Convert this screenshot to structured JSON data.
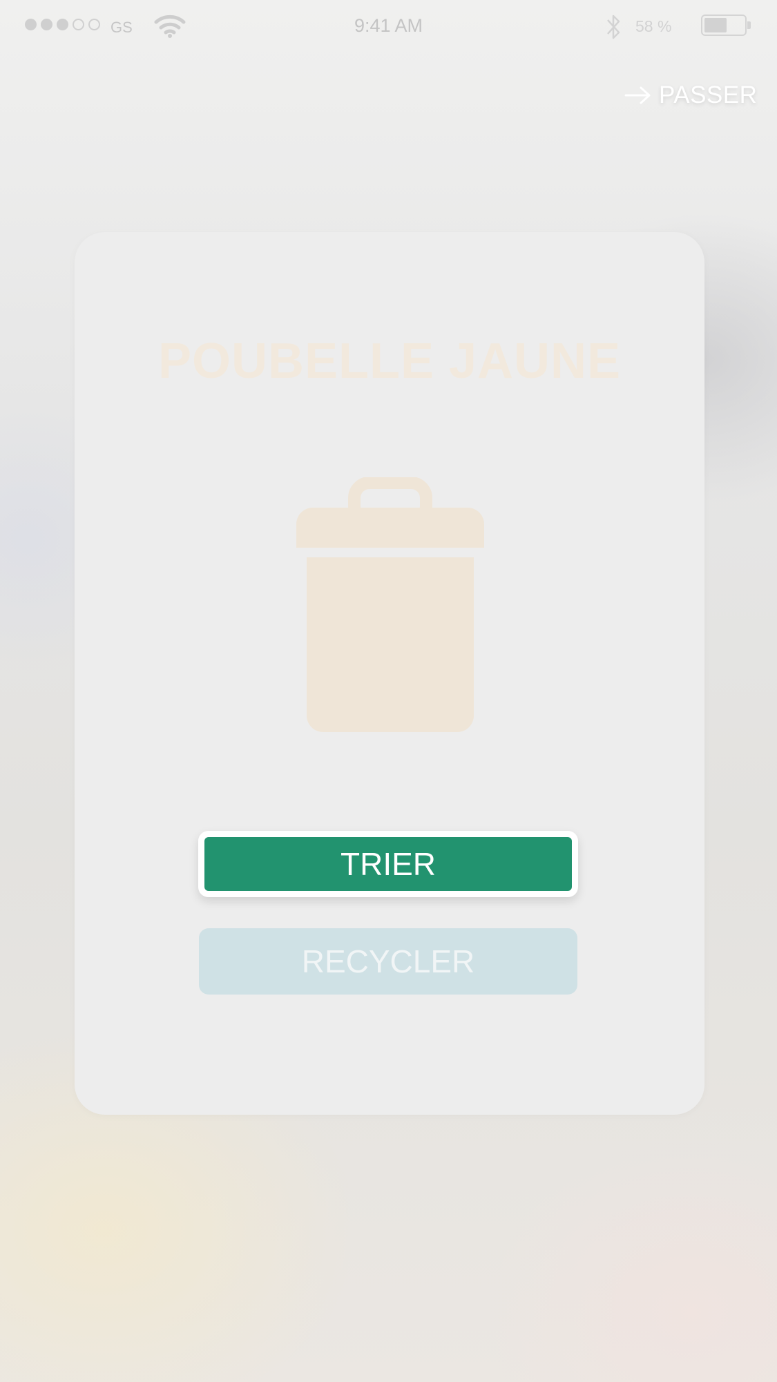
{
  "status_bar": {
    "signal_filled": 3,
    "signal_total": 5,
    "carrier": "GS",
    "time": "9:41 AM",
    "battery_percent": "58 %",
    "battery_level": 0.58
  },
  "header": {
    "skip_label": "PASSER",
    "skip_icon": "arrow-right-icon"
  },
  "card": {
    "title": "POUBELLE JAUNE",
    "illustration_icon": "trash-bin-icon",
    "title_color": "#f2e9dd",
    "illustration_color": "#efe5d7",
    "primary_button": {
      "label": "TRIER",
      "color": "#22936f"
    },
    "secondary_button": {
      "label": "RECYCLER",
      "color": "#cfe1e5"
    }
  }
}
